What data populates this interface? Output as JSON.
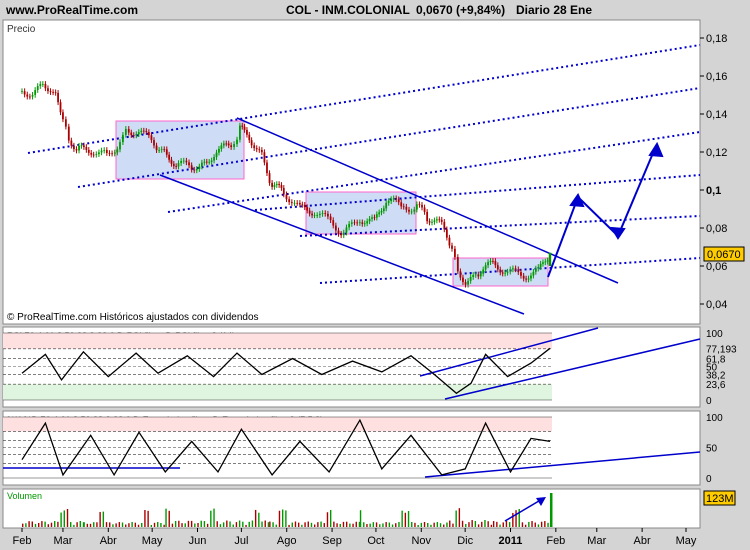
{
  "header": {
    "site": "www.ProRealTime.com",
    "title": "COL - INM.COLONIAL",
    "last": "0,0670 (+9,84%)",
    "period": "Diario  28 Ene"
  },
  "price_panel": {
    "label": "Precio",
    "footer": "© ProRealTime.com  Históricos ajustados con dividendos",
    "last_tag": "0,0670",
    "y_ticks": [
      {
        "value": 0.18,
        "label": "0,18"
      },
      {
        "value": 0.16,
        "label": "0,16"
      },
      {
        "value": 0.14,
        "label": "0,14"
      },
      {
        "value": 0.12,
        "label": "0,12"
      },
      {
        "value": 0.1,
        "label": "0,1"
      },
      {
        "value": 0.08,
        "label": "0,08"
      },
      {
        "value": 0.06,
        "label": "0,06"
      },
      {
        "value": 0.04,
        "label": "0,04"
      }
    ]
  },
  "rsi_panel": {
    "legend": "RSI 76.4 61.8 50 38.2 23.6 D-RSI fibos D-RSI fibos2 (14)",
    "y_ticks": [
      "100",
      "77,193",
      "61,8",
      "50",
      "38,2",
      "23,6",
      "0"
    ],
    "levels": [
      100,
      76.4,
      61.8,
      50,
      38.2,
      23.6,
      0
    ],
    "last_value": 77.193
  },
  "stoch_panel": {
    "legend": "%K %D 76.4 61.8 50 38.2 23.6 D-Estocástico fibos D-Estocástico fibos2 (7 5 3)",
    "y_ticks": [
      "100",
      "50",
      "0"
    ],
    "levels": [
      100,
      76.4,
      61.8,
      50,
      38.2,
      23.6,
      0
    ]
  },
  "volume_panel": {
    "label": "Volumen",
    "last_tag": "123M"
  },
  "x_axis": [
    "Feb",
    "Mar",
    "Abr",
    "May",
    "Jun",
    "Jul",
    "Ago",
    "Sep",
    "Oct",
    "Nov",
    "Dic",
    "2011",
    "Feb",
    "Mar",
    "Abr",
    "May"
  ],
  "colors": {
    "up": "#009900",
    "down": "#aa0000",
    "line": "#0000cc",
    "box_fill": "#cfdcf5",
    "box_stroke": "#ff66cc",
    "tag": "#ffcc00"
  },
  "chart_data": {
    "type": "candlestick",
    "title": "COL - INM.COLONIAL",
    "period": "Diario",
    "ylim": [
      0.033,
      0.19
    ],
    "price_series": [
      {
        "x": "2010-02-01",
        "close": 0.152
      },
      {
        "x": "2010-02-10",
        "close": 0.151
      },
      {
        "x": "2010-02-17",
        "close": 0.156
      },
      {
        "x": "2010-02-24",
        "close": 0.149
      },
      {
        "x": "2010-03-01",
        "close": 0.138
      },
      {
        "x": "2010-03-05",
        "close": 0.127
      },
      {
        "x": "2010-03-12",
        "close": 0.121
      },
      {
        "x": "2010-03-22",
        "close": 0.121
      },
      {
        "x": "2010-03-31",
        "close": 0.118
      },
      {
        "x": "2010-04-09",
        "close": 0.125
      },
      {
        "x": "2010-04-15",
        "close": 0.132
      },
      {
        "x": "2010-04-27",
        "close": 0.128
      },
      {
        "x": "2010-05-04",
        "close": 0.123
      },
      {
        "x": "2010-05-11",
        "close": 0.118
      },
      {
        "x": "2010-05-19",
        "close": 0.113
      },
      {
        "x": "2010-05-28",
        "close": 0.113
      },
      {
        "x": "2010-06-04",
        "close": 0.112
      },
      {
        "x": "2010-06-14",
        "close": 0.121
      },
      {
        "x": "2010-06-24",
        "close": 0.123
      },
      {
        "x": "2010-06-30",
        "close": 0.132
      },
      {
        "x": "2010-07-08",
        "close": 0.126
      },
      {
        "x": "2010-07-15",
        "close": 0.118
      },
      {
        "x": "2010-07-22",
        "close": 0.102
      },
      {
        "x": "2010-07-30",
        "close": 0.099
      },
      {
        "x": "2010-08-10",
        "close": 0.09
      },
      {
        "x": "2010-08-20",
        "close": 0.089
      },
      {
        "x": "2010-08-31",
        "close": 0.083
      },
      {
        "x": "2010-09-09",
        "close": 0.077
      },
      {
        "x": "2010-09-20",
        "close": 0.085
      },
      {
        "x": "2010-09-30",
        "close": 0.083
      },
      {
        "x": "2010-10-08",
        "close": 0.095
      },
      {
        "x": "2010-10-20",
        "close": 0.091
      },
      {
        "x": "2010-10-29",
        "close": 0.091
      },
      {
        "x": "2010-11-05",
        "close": 0.086
      },
      {
        "x": "2010-11-15",
        "close": 0.081
      },
      {
        "x": "2010-11-22",
        "close": 0.07
      },
      {
        "x": "2010-11-26",
        "close": 0.058
      },
      {
        "x": "2010-12-03",
        "close": 0.05
      },
      {
        "x": "2010-12-10",
        "close": 0.057
      },
      {
        "x": "2010-12-20",
        "close": 0.061
      },
      {
        "x": "2010-12-30",
        "close": 0.057
      },
      {
        "x": "2011-01-10",
        "close": 0.055
      },
      {
        "x": "2011-01-20",
        "close": 0.057
      },
      {
        "x": "2011-01-28",
        "close": 0.067
      }
    ],
    "rsi_series": [
      {
        "x": "2010-02-01",
        "value": 40
      },
      {
        "x": "2010-02-17",
        "value": 68
      },
      {
        "x": "2010-02-28",
        "value": 30
      },
      {
        "x": "2010-03-15",
        "value": 72
      },
      {
        "x": "2010-04-01",
        "value": 35
      },
      {
        "x": "2010-04-20",
        "value": 70
      },
      {
        "x": "2010-05-05",
        "value": 40
      },
      {
        "x": "2010-05-25",
        "value": 66
      },
      {
        "x": "2010-06-12",
        "value": 35
      },
      {
        "x": "2010-06-28",
        "value": 70
      },
      {
        "x": "2010-07-15",
        "value": 38
      },
      {
        "x": "2010-08-05",
        "value": 62
      },
      {
        "x": "2010-08-25",
        "value": 38
      },
      {
        "x": "2010-09-15",
        "value": 58
      },
      {
        "x": "2010-10-05",
        "value": 42
      },
      {
        "x": "2010-10-25",
        "value": 66
      },
      {
        "x": "2010-11-10",
        "value": 38
      },
      {
        "x": "2010-11-25",
        "value": 10
      },
      {
        "x": "2010-12-05",
        "value": 25
      },
      {
        "x": "2010-12-15",
        "value": 68
      },
      {
        "x": "2010-12-30",
        "value": 35
      },
      {
        "x": "2011-01-15",
        "value": 55
      },
      {
        "x": "2011-01-28",
        "value": 77.193
      }
    ],
    "stoch_series": [
      {
        "x": "2010-02-01",
        "value": 30
      },
      {
        "x": "2010-02-17",
        "value": 90
      },
      {
        "x": "2010-03-01",
        "value": 5
      },
      {
        "x": "2010-03-20",
        "value": 70
      },
      {
        "x": "2010-04-05",
        "value": 5
      },
      {
        "x": "2010-04-22",
        "value": 75
      },
      {
        "x": "2010-05-10",
        "value": 10
      },
      {
        "x": "2010-05-28",
        "value": 60
      },
      {
        "x": "2010-06-15",
        "value": 10
      },
      {
        "x": "2010-07-01",
        "value": 80
      },
      {
        "x": "2010-07-22",
        "value": 5
      },
      {
        "x": "2010-08-10",
        "value": 60
      },
      {
        "x": "2010-08-30",
        "value": 10
      },
      {
        "x": "2010-09-20",
        "value": 95
      },
      {
        "x": "2010-10-05",
        "value": 15
      },
      {
        "x": "2010-10-25",
        "value": 70
      },
      {
        "x": "2010-11-15",
        "value": 5
      },
      {
        "x": "2010-12-01",
        "value": 15
      },
      {
        "x": "2010-12-15",
        "value": 90
      },
      {
        "x": "2011-01-01",
        "value": 10
      },
      {
        "x": "2011-01-15",
        "value": 65
      },
      {
        "x": "2011-01-28",
        "value": 60
      }
    ],
    "volume_series": [
      {
        "x": "2010-02-01",
        "value": 40
      },
      {
        "x": "2010-03-15",
        "value": 30
      },
      {
        "x": "2010-05-10",
        "value": 45
      },
      {
        "x": "2010-07-20",
        "value": 35
      },
      {
        "x": "2010-09-20",
        "value": 30
      },
      {
        "x": "2010-11-20",
        "value": 50
      },
      {
        "x": "2010-12-20",
        "value": 40
      },
      {
        "x": "2011-01-28",
        "value": 123
      }
    ]
  }
}
